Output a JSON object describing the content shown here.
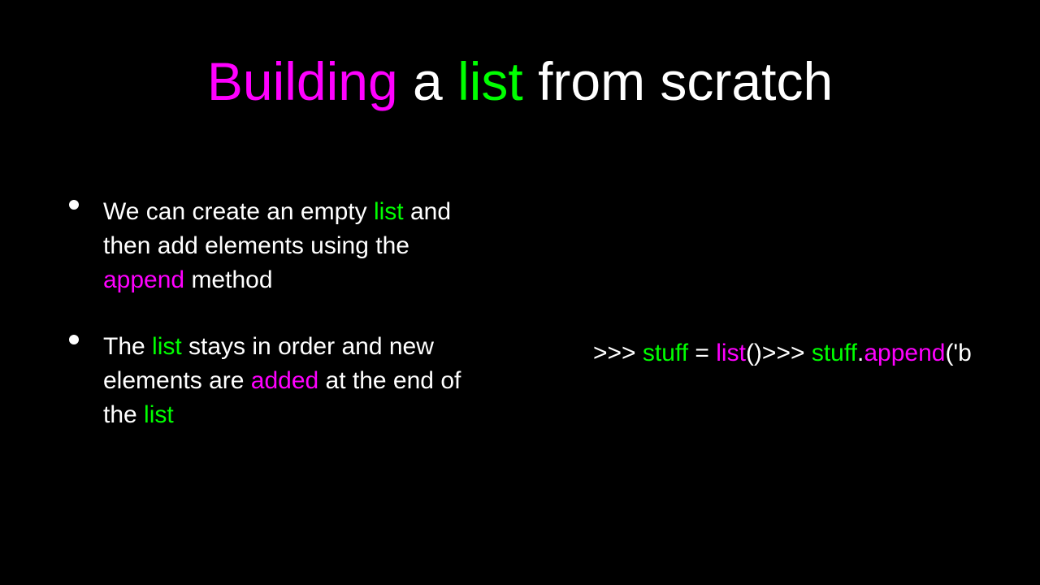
{
  "title": {
    "w1": "Building",
    "w2": " a ",
    "w3": "list",
    "w4": " from scratch"
  },
  "bullets": [
    {
      "t1": "We can create an empty ",
      "t2": "list",
      "t3": " and then add elements using the ",
      "t4": "append",
      "t5": " method"
    },
    {
      "t1": "The ",
      "t2": "list",
      "t3": " stays in order and new elements are ",
      "t4": "added",
      "t5": " at the end of the ",
      "t6": "list"
    }
  ],
  "code": {
    "c1": ">>> ",
    "c2": "stuff",
    "c3": " = ",
    "c4": "list",
    "c5": "()",
    "c6": ">>> ",
    "c7": "stuff",
    "c8": ".",
    "c9": "append",
    "c10": "('b"
  }
}
